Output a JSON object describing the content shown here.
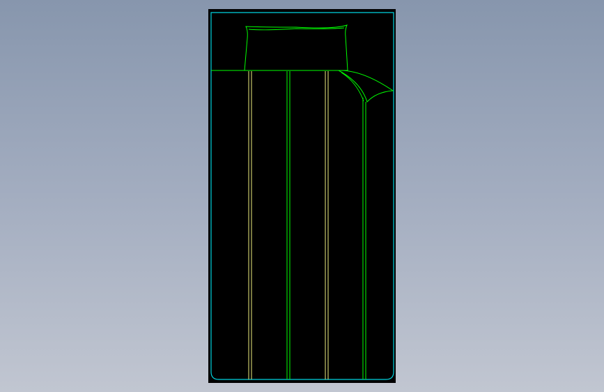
{
  "drawing": {
    "subject": "single-bed-plan",
    "background_color": "#000000",
    "colors": {
      "outline": "#00d4e0",
      "pillow_and_sheet": "#00ff00",
      "stripes_alt": "#f0f080"
    }
  }
}
